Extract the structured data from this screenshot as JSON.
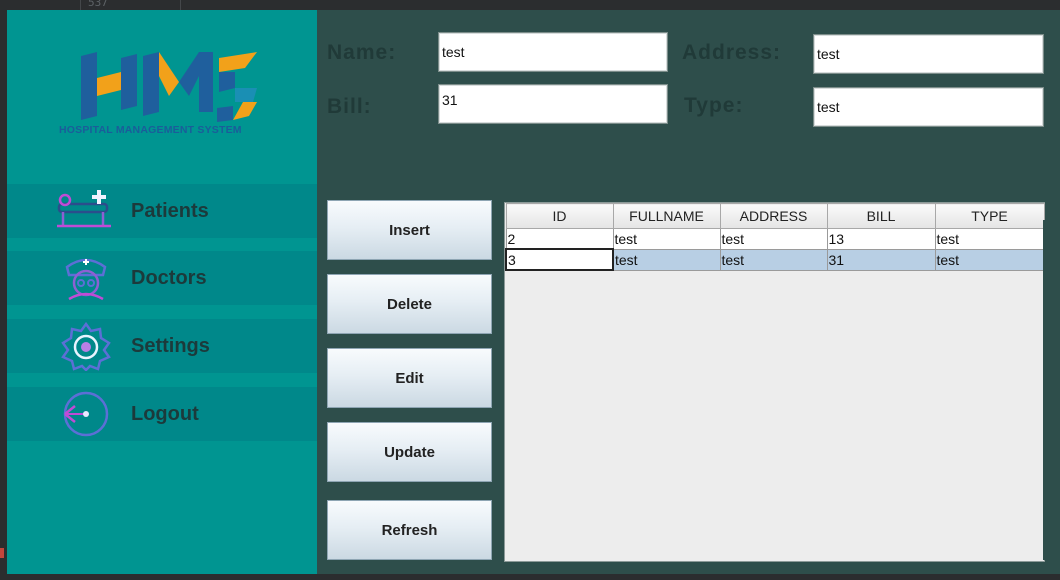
{
  "background": {
    "code_text": "537"
  },
  "sidebar": {
    "logo_caption": "HOSPITAL MANAGEMENT SYSTEM",
    "items": [
      {
        "label": "Patients",
        "icon": "patient-bed-icon"
      },
      {
        "label": "Doctors",
        "icon": "doctor-icon"
      },
      {
        "label": "Settings",
        "icon": "settings-icon"
      },
      {
        "label": "Logout",
        "icon": "logout-icon"
      }
    ]
  },
  "form": {
    "name_label": "Name:",
    "name_value": "test",
    "address_label": "Address:",
    "address_value": "test",
    "bill_label": "Bill:",
    "bill_value": "31",
    "type_label": "Type:",
    "type_value": "test"
  },
  "buttons": {
    "insert": "Insert",
    "delete": "Delete",
    "edit": "Edit",
    "update": "Update",
    "refresh": "Refresh"
  },
  "table": {
    "columns": [
      "ID",
      "FULLNAME",
      "ADDRESS",
      "BILL",
      "TYPE"
    ],
    "rows": [
      [
        "2",
        "test",
        "test",
        "13",
        "test"
      ],
      [
        "3",
        "test",
        "test",
        "31",
        "test"
      ]
    ],
    "selected_row": 1
  },
  "colors": {
    "sidebar": "#009591",
    "sidebar_item": "#00888a",
    "main_panel": "#2e4e4b",
    "selection": "#b8cfe4"
  }
}
